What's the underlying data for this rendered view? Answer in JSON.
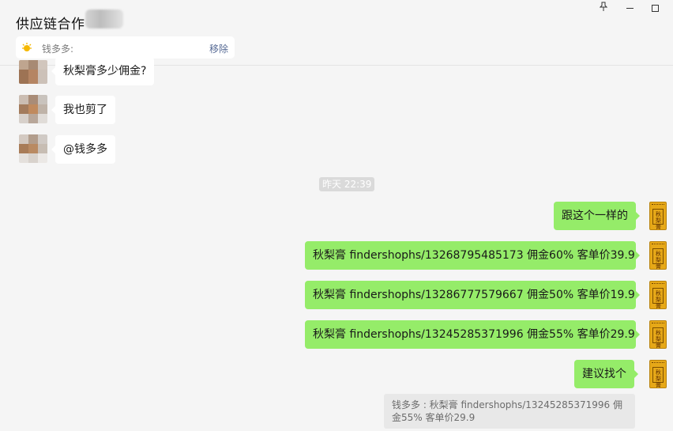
{
  "window": {
    "title": "供应链合作",
    "pin_icon": "pin-icon",
    "min_icon": "minimize-icon",
    "max_icon": "maximize-icon"
  },
  "notice": {
    "text": "钱多多:",
    "remove_label": "移除",
    "icon": "sun-icon"
  },
  "messages_left": [
    {
      "text": "秋梨膏多少佣金?"
    },
    {
      "text": "我也剪了"
    },
    {
      "text": "@钱多多"
    }
  ],
  "timestamp": "昨天 22:39",
  "messages_right": [
    {
      "text": "跟这个一样的"
    },
    {
      "text": "秋梨膏 findershophs/13268795485173  佣金60%  客单价39.9"
    },
    {
      "text": "秋梨膏 findershophs/13286777579667  佣金50%  客单价19.9"
    },
    {
      "text": "秋梨膏 findershophs/13245285371996  佣金55%  客单价29.9"
    },
    {
      "text": "建议找个"
    }
  ],
  "quote": {
    "text": "钱多多 : 秋梨膏 findershophs/13245285371996  佣金55%  客单价29.9"
  },
  "colors": {
    "bubble_self": "#95ec69",
    "bubble_other": "#ffffff",
    "background": "#f5f5f5",
    "link": "#576b95",
    "avatar_gold": "#e6a818"
  }
}
